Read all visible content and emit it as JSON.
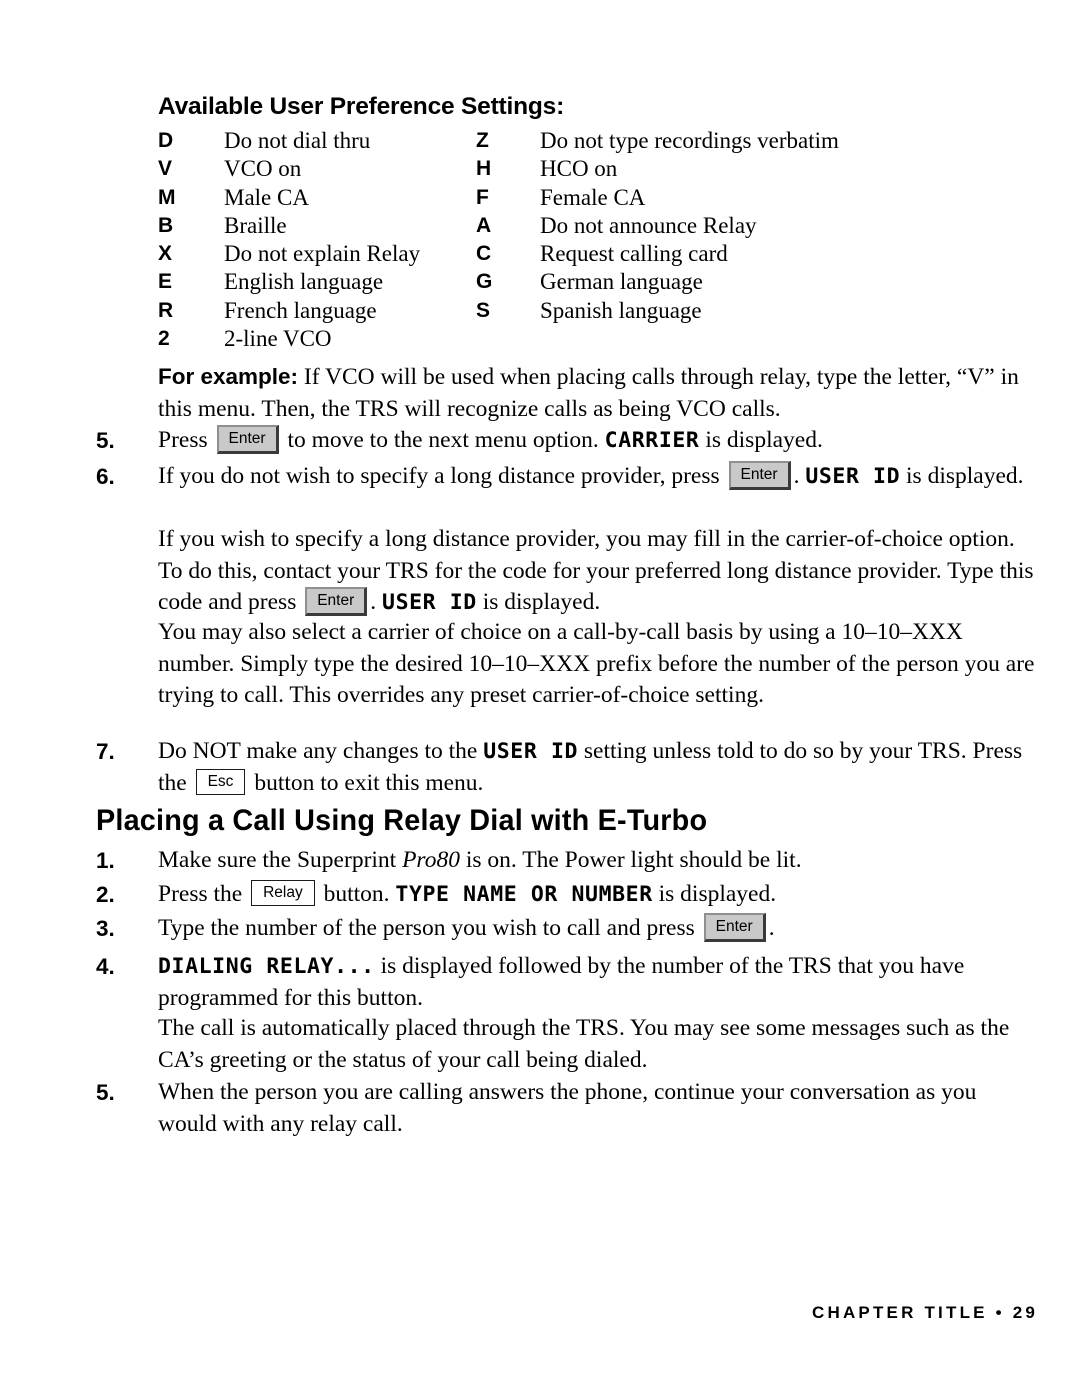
{
  "page": {
    "settings_title": "Available User Preference Settings:",
    "section_heading": "Placing a Call Using Relay Dial with E-Turbo",
    "footer": "CHAPTER TITLE • 29"
  },
  "preferences": {
    "column_a": [
      {
        "code": "D",
        "description": "Do not dial thru"
      },
      {
        "code": "V",
        "description": "VCO on"
      },
      {
        "code": "M",
        "description": "Male CA"
      },
      {
        "code": "B",
        "description": "Braille"
      },
      {
        "code": "X",
        "description": "Do not explain Relay"
      },
      {
        "code": "E",
        "description": "English language"
      },
      {
        "code": "R",
        "description": "French language"
      },
      {
        "code": "2",
        "description": "2-line VCO"
      }
    ],
    "column_b": [
      {
        "code": "Z",
        "description": "Do not type recordings verbatim"
      },
      {
        "code": "H",
        "description": "HCO on"
      },
      {
        "code": "F",
        "description": "Female CA"
      },
      {
        "code": "A",
        "description": "Do not announce Relay"
      },
      {
        "code": "C",
        "description": "Request calling card"
      },
      {
        "code": "G",
        "description": "German language"
      },
      {
        "code": "S",
        "description": "Spanish language"
      }
    ]
  },
  "example": {
    "lead": "For example:",
    "text": " If VCO will be used when placing calls through relay, type the letter, “V” in this menu. Then, the TRS will recognize calls as being VCO calls."
  },
  "steps_menu": {
    "step5": {
      "number": "5.",
      "text_before_key": "Press ",
      "key": "Enter",
      "text_after_key": " to move to the next menu option. ",
      "display": "CARRIER",
      "text_end": " is displayed."
    },
    "step6": {
      "number": "6.",
      "text_before_key": "If you do not wish to specify a long distance provider, press ",
      "key": "Enter",
      "text_after_key": ". ",
      "display": "USER ID",
      "text_end": " is displayed."
    },
    "para_carrier_choice": {
      "text_before_key": "If you wish to specify a long distance provider, you may fill in the carrier-of-choice option. To do this, contact your TRS for the code for your preferred long distance provider. Type this code and press ",
      "key": "Enter",
      "text_after_key": ". ",
      "display": "USER ID",
      "text_end": " is displayed."
    },
    "para_ten_ten": {
      "text": "You may also select a carrier of choice on a call-by-call basis by using a 10–10–XXX number. Simply type the desired 10–10–XXX prefix before the number of the person you are trying to call. This overrides any preset carrier-of-choice setting."
    },
    "step7": {
      "number": "7.",
      "text_before_display": "Do NOT make any changes to the ",
      "display": "USER ID",
      "text_after_display": " setting unless told to do so by your TRS. Press the ",
      "key": "Esc",
      "text_end": " button to exit this menu."
    }
  },
  "steps_relay": {
    "step1": {
      "number": "1.",
      "text_before_italic": "Make sure the Superprint ",
      "italic": "Pro80",
      "text_after_italic": " is on. The Power light should be lit."
    },
    "step2": {
      "number": "2.",
      "text_before_key": "Press the ",
      "key": "Relay",
      "text_after_key": " button. ",
      "display": "TYPE NAME OR NUMBER",
      "text_end": " is displayed."
    },
    "step3": {
      "number": "3.",
      "text_before_key": "Type the number of the person you wish to call and press ",
      "key": "Enter",
      "text_after_key": "."
    },
    "step4": {
      "number": "4.",
      "display": "DIALING RELAY...",
      "text_end": " is displayed followed by the number of the TRS that you have programmed for this button."
    },
    "para_auto_place": {
      "text": "The call is automatically placed through the TRS. You may see some messages such as the CA’s greeting or the status of your call being dialed."
    },
    "step5": {
      "number": "5.",
      "text": "When the person you are calling answers the phone, continue your conversation as you would with any relay call."
    }
  }
}
